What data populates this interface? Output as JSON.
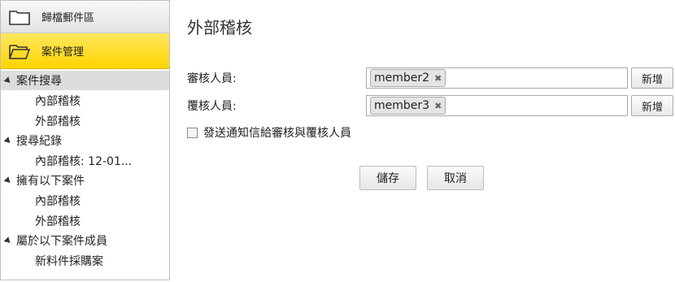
{
  "sidebar": {
    "archive": {
      "label": "歸檔郵件區",
      "icon": "folder-icon"
    },
    "case_mgmt": {
      "label": "案件管理",
      "icon": "folder-open-icon",
      "active_color": "#ffd400"
    },
    "groups": [
      {
        "label": "案件搜尋",
        "items": [
          "內部稽核",
          "外部稽核"
        ]
      },
      {
        "label": "搜尋紀錄",
        "items": [
          "內部稽核: 12-01..."
        ]
      },
      {
        "label": "擁有以下案件",
        "items": [
          "內部稽核",
          "外部稽核"
        ]
      },
      {
        "label": "屬於以下案件成員",
        "items": [
          "新料件採購案"
        ]
      }
    ]
  },
  "main": {
    "title": "外部稽核",
    "reviewer": {
      "label": "審核人員:",
      "chip": "member2",
      "add_label": "新增"
    },
    "rechecker": {
      "label": "覆核人員:",
      "chip": "member3",
      "add_label": "新增"
    },
    "notify": {
      "label": "發送通知信給審核與覆核人員",
      "checked": false
    },
    "save_label": "儲存",
    "cancel_label": "取消"
  }
}
